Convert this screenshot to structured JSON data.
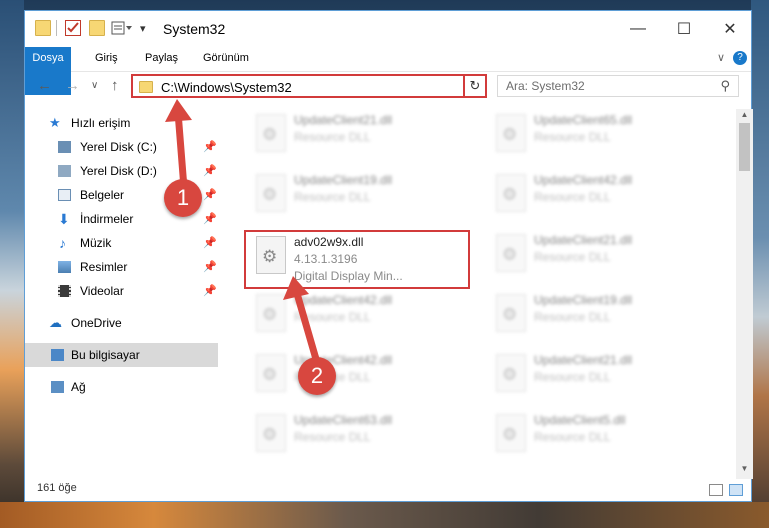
{
  "titlebar": {
    "title": "System32",
    "minimize": "—",
    "maximize": "☐",
    "close": "✕"
  },
  "ribbon": {
    "tabs": [
      "Dosya",
      "Giriş",
      "Paylaş",
      "Görünüm"
    ],
    "collapse": "∨",
    "help": "?"
  },
  "address": {
    "path": "C:\\Windows\\System32",
    "back": "←",
    "forward": "→",
    "recent": "∨",
    "up": "↑",
    "dropdown": "∨",
    "refresh": "↻"
  },
  "search": {
    "placeholder": "Ara: System32",
    "icon": "⚲"
  },
  "nav": {
    "quick_access": "Hızlı erişim",
    "items": [
      "Yerel Disk (C:)",
      "Yerel Disk (D:)",
      "Belgeler",
      "İndirmeler",
      "Müzik",
      "Resimler",
      "Videolar"
    ],
    "onedrive": "OneDrive",
    "this_pc": "Bu bilgisayar",
    "network": "Ağ",
    "pin": "📌"
  },
  "files": {
    "col1": [
      {
        "name": "UpdateClient21.dll",
        "desc": "Resource DLL"
      },
      {
        "name": "UpdateClient19.dll",
        "desc": "Resource DLL"
      },
      {
        "name": "adv02w9x.dll",
        "desc": "4.13.1.3196",
        "desc2": "Digital Display Min..."
      },
      {
        "name": "UpdateClient42.dll",
        "desc": "Resource DLL"
      },
      {
        "name": "UpdateClient42.dll",
        "desc": "Resource DLL"
      },
      {
        "name": "UpdateClient63.dll",
        "desc": "Resource DLL"
      }
    ],
    "col2": [
      {
        "name": "UpdateClient65.dll",
        "desc": "Resource DLL"
      },
      {
        "name": "UpdateClient42.dll",
        "desc": "Resource DLL"
      },
      {
        "name": "UpdateClient21.dll",
        "desc": "Resource DLL"
      },
      {
        "name": "UpdateClient19.dll",
        "desc": "Resource DLL"
      },
      {
        "name": "UpdateClient21.dll",
        "desc": "Resource DLL"
      },
      {
        "name": "UpdateClient5.dll",
        "desc": "Resource DLL"
      }
    ]
  },
  "status": {
    "count": "161 öğe"
  },
  "callouts": [
    "1",
    "2"
  ],
  "colors": {
    "accent": "#1979ca",
    "highlight": "#d23b3b"
  }
}
